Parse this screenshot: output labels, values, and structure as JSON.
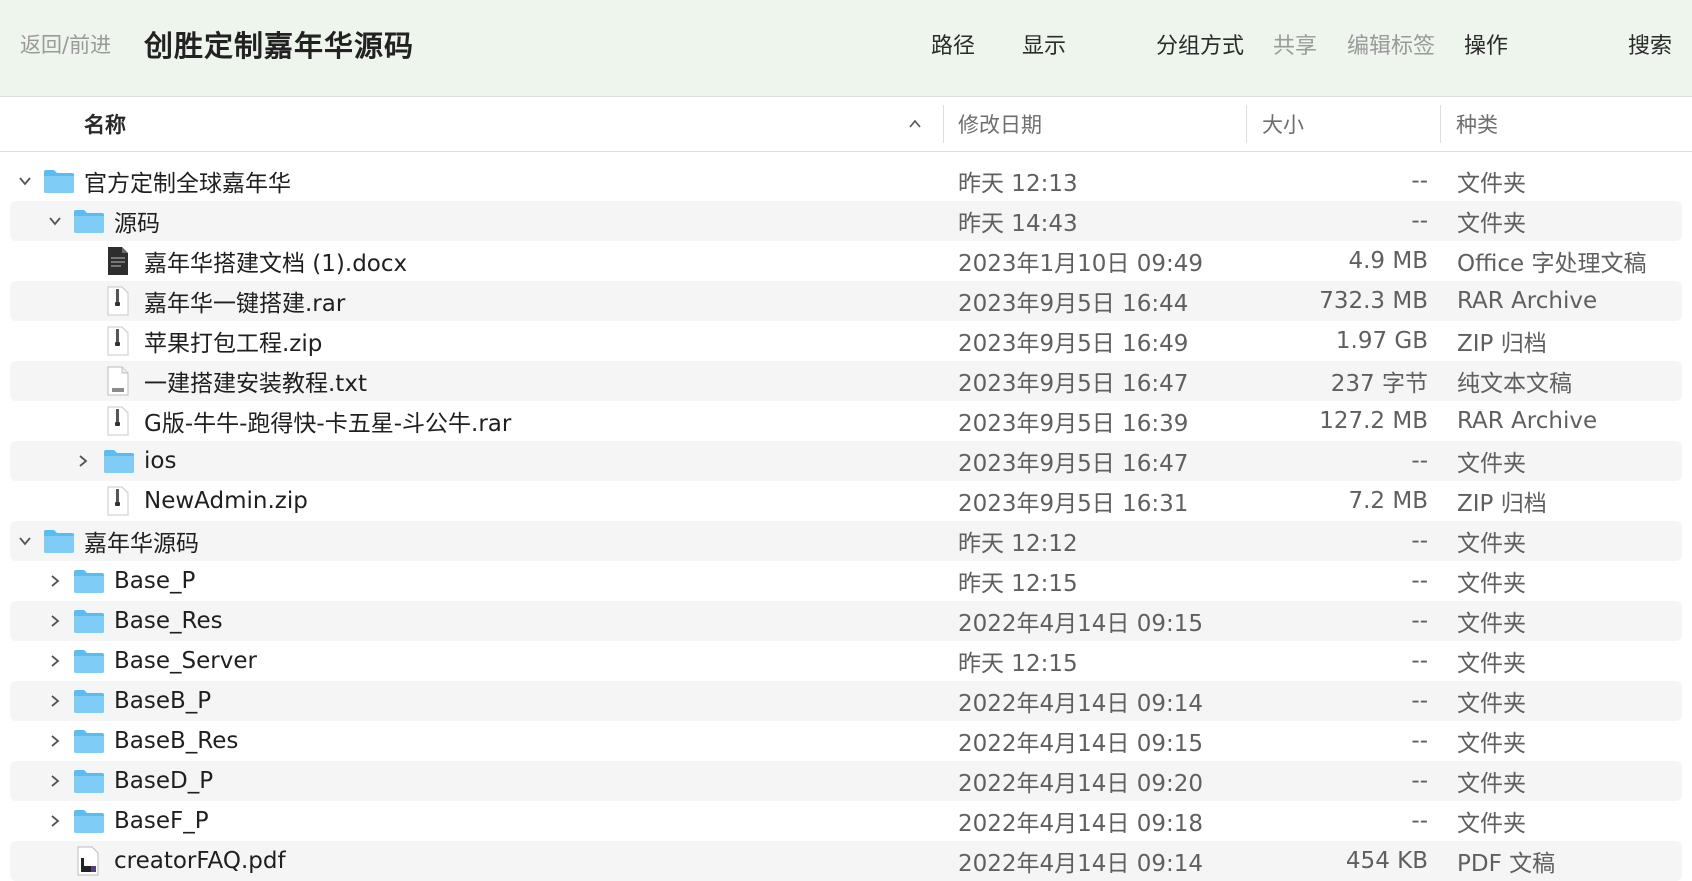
{
  "toolbar": {
    "back_forward": "返回/前进",
    "title": "创胜定制嘉年华源码",
    "path": "路径",
    "display": "显示",
    "group_by": "分组方式",
    "share": "共享",
    "edit_tags": "编辑标签",
    "actions": "操作",
    "search": "搜索"
  },
  "columns": {
    "name": "名称",
    "date": "修改日期",
    "size": "大小",
    "kind": "种类"
  },
  "rows": [
    {
      "name": "官方定制全球嘉年华",
      "date": "昨天 12:13",
      "size": "--",
      "kind": "文件夹",
      "icon": "folder-icon",
      "expand": "expanded"
    },
    {
      "name": "源码",
      "date": "昨天 14:43",
      "size": "--",
      "kind": "文件夹",
      "icon": "folder-icon",
      "expand": "expanded"
    },
    {
      "name": "嘉年华搭建文档 (1).docx",
      "date": "2023年1月10日 09:49",
      "size": "4.9 MB",
      "kind": "Office 字处理文稿",
      "icon": "docx-file-icon",
      "expand": "none"
    },
    {
      "name": "嘉年华一键搭建.rar",
      "date": "2023年9月5日 16:44",
      "size": "732.3 MB",
      "kind": "RAR Archive",
      "icon": "archive-file-icon",
      "expand": "none"
    },
    {
      "name": "苹果打包工程.zip",
      "date": "2023年9月5日 16:49",
      "size": "1.97 GB",
      "kind": "ZIP 归档",
      "icon": "archive-file-icon",
      "expand": "none"
    },
    {
      "name": "一建搭建安装教程.txt",
      "date": "2023年9月5日 16:47",
      "size": "237 字节",
      "kind": "纯文本文稿",
      "icon": "txt-file-icon",
      "expand": "none"
    },
    {
      "name": "G版-牛牛-跑得快-卡五星-斗公牛.rar",
      "date": "2023年9月5日 16:39",
      "size": "127.2 MB",
      "kind": "RAR Archive",
      "icon": "archive-file-icon",
      "expand": "none"
    },
    {
      "name": "ios",
      "date": "2023年9月5日 16:47",
      "size": "--",
      "kind": "文件夹",
      "icon": "folder-icon",
      "expand": "collapsed"
    },
    {
      "name": "NewAdmin.zip",
      "date": "2023年9月5日 16:31",
      "size": "7.2 MB",
      "kind": "ZIP 归档",
      "icon": "archive-file-icon",
      "expand": "none"
    },
    {
      "name": "嘉年华源码",
      "date": "昨天 12:12",
      "size": "--",
      "kind": "文件夹",
      "icon": "folder-icon",
      "expand": "expanded"
    },
    {
      "name": "Base_P",
      "date": "昨天 12:15",
      "size": "--",
      "kind": "文件夹",
      "icon": "folder-icon",
      "expand": "collapsed"
    },
    {
      "name": "Base_Res",
      "date": "2022年4月14日 09:15",
      "size": "--",
      "kind": "文件夹",
      "icon": "folder-icon",
      "expand": "collapsed"
    },
    {
      "name": "Base_Server",
      "date": "昨天 12:15",
      "size": "--",
      "kind": "文件夹",
      "icon": "folder-icon",
      "expand": "collapsed"
    },
    {
      "name": "BaseB_P",
      "date": "2022年4月14日 09:14",
      "size": "--",
      "kind": "文件夹",
      "icon": "folder-icon",
      "expand": "collapsed"
    },
    {
      "name": "BaseB_Res",
      "date": "2022年4月14日 09:15",
      "size": "--",
      "kind": "文件夹",
      "icon": "folder-icon",
      "expand": "collapsed"
    },
    {
      "name": "BaseD_P",
      "date": "2022年4月14日 09:20",
      "size": "--",
      "kind": "文件夹",
      "icon": "folder-icon",
      "expand": "collapsed"
    },
    {
      "name": "BaseF_P",
      "date": "2022年4月14日 09:18",
      "size": "--",
      "kind": "文件夹",
      "icon": "folder-icon",
      "expand": "collapsed"
    },
    {
      "name": "creatorFAQ.pdf",
      "date": "2022年4月14日 09:14",
      "size": "454 KB",
      "kind": "PDF 文稿",
      "icon": "pdf-file-icon",
      "expand": "none"
    }
  ]
}
